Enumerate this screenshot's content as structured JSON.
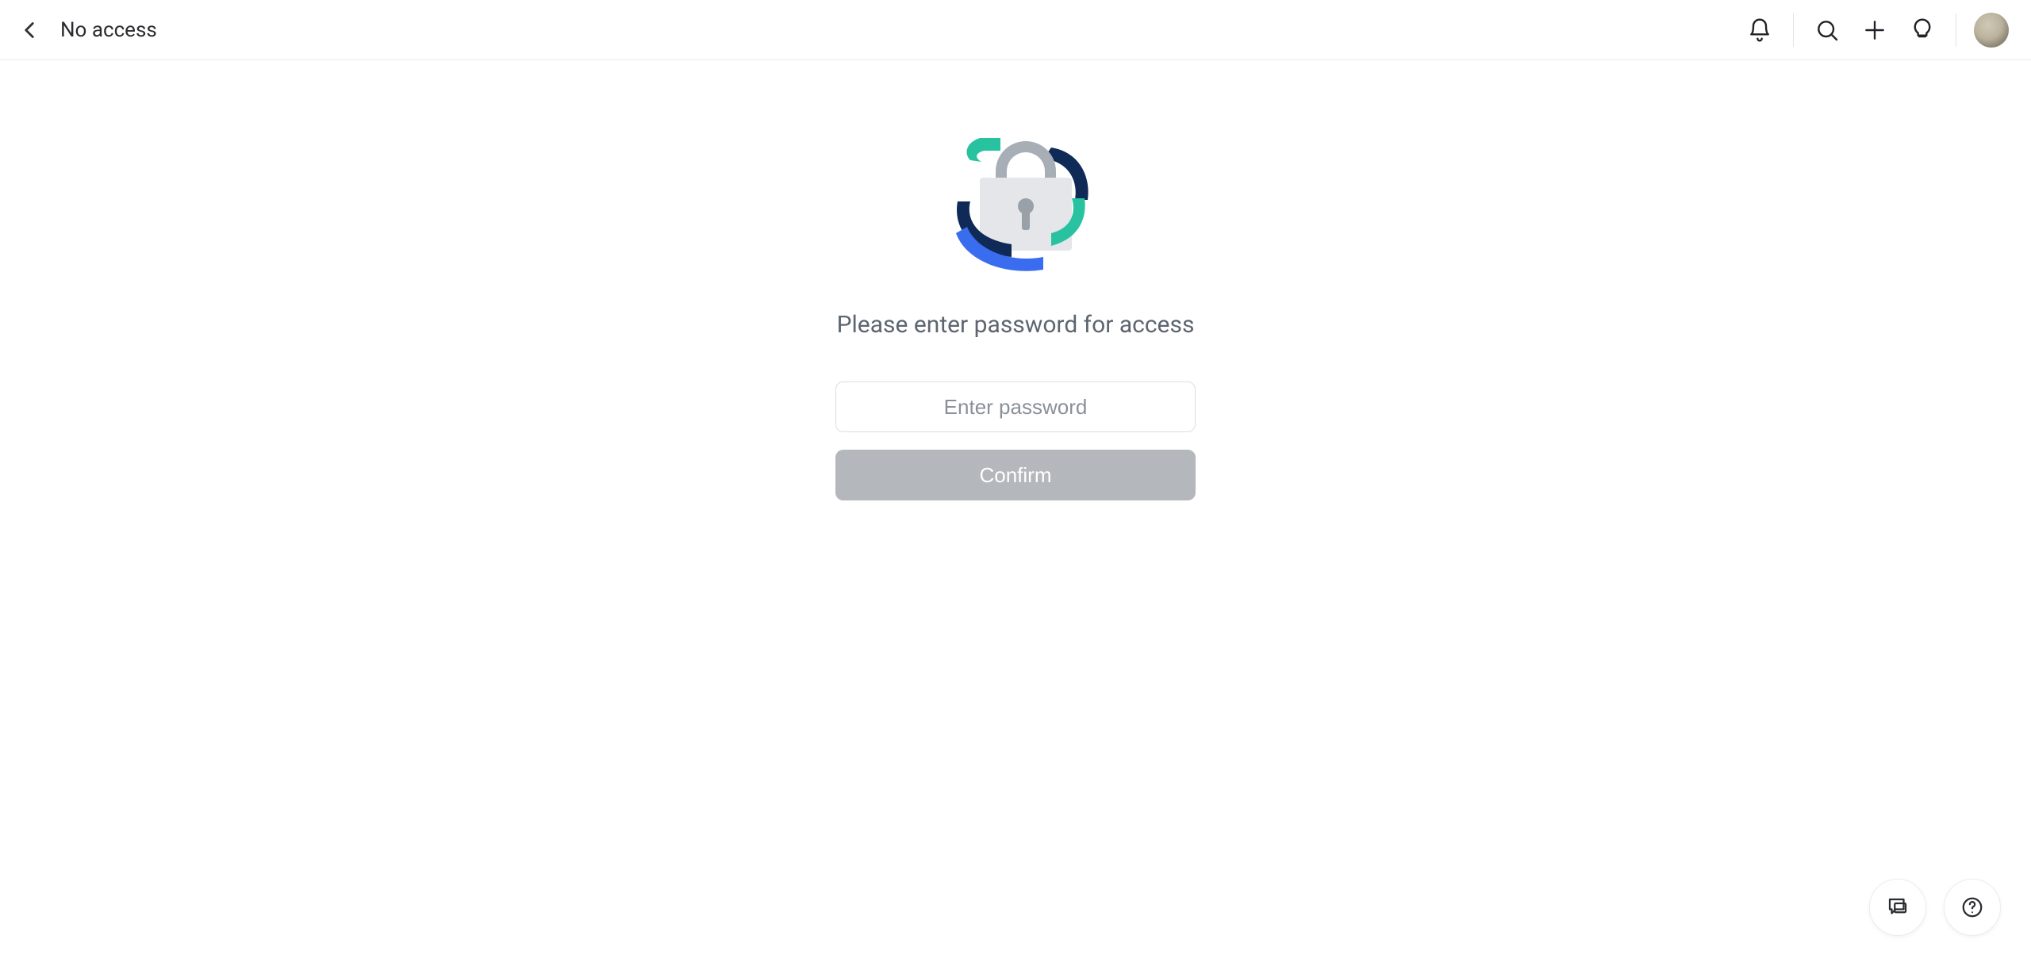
{
  "header": {
    "title": "No access"
  },
  "main": {
    "prompt": "Please enter password for access",
    "password_placeholder": "Enter password",
    "confirm_label": "Confirm"
  }
}
